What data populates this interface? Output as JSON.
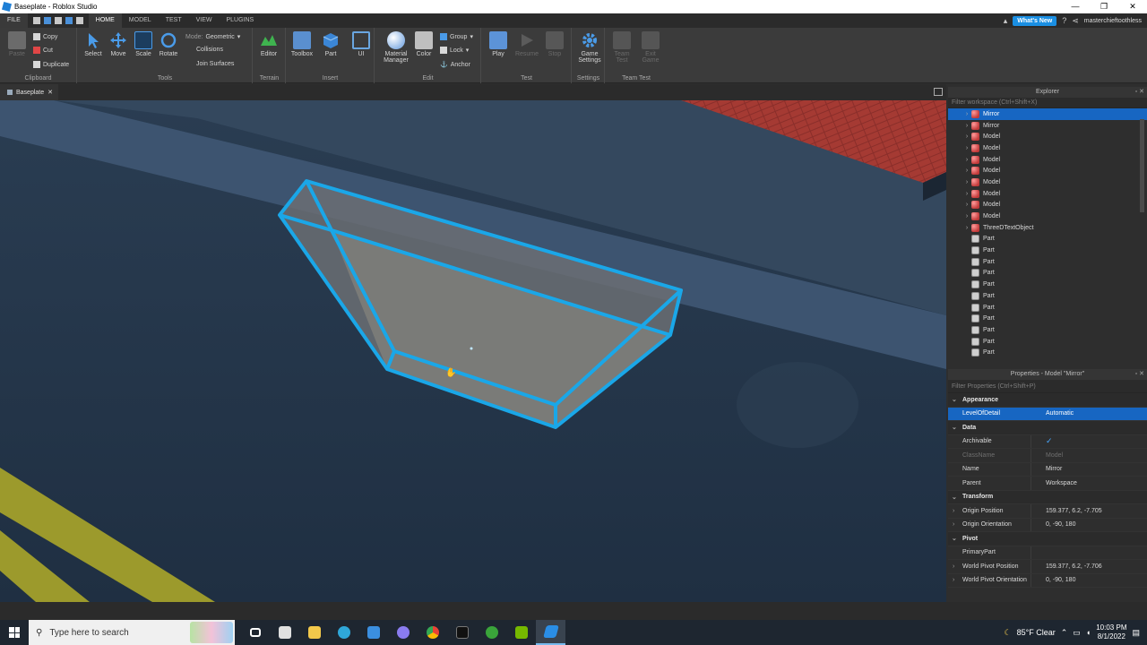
{
  "window": {
    "title": "Baseplate - Roblox Studio",
    "controls": [
      "—",
      "❐",
      "✕"
    ]
  },
  "menubar": {
    "tabs": [
      "FILE",
      "HOME",
      "MODEL",
      "TEST",
      "VIEW",
      "PLUGINS"
    ],
    "active_tab": "HOME",
    "whats_new": "What's New",
    "username": "masterchieftoothless"
  },
  "ribbon": {
    "clipboard": {
      "paste": "Paste",
      "copy": "Copy",
      "cut": "Cut",
      "duplicate": "Duplicate",
      "label": "Clipboard"
    },
    "tools": {
      "select": "Select",
      "move": "Move",
      "scale": "Scale",
      "rotate": "Rotate",
      "mode_label": "Mode:",
      "mode_value": "Geometric",
      "collisions": "Collisions",
      "join_surfaces": "Join Surfaces",
      "label": "Tools"
    },
    "terrain": {
      "editor": "Editor",
      "label": "Terrain"
    },
    "insert": {
      "toolbox": "Toolbox",
      "part": "Part",
      "ui": "UI",
      "label": "Insert"
    },
    "edit": {
      "material_manager_1": "Material",
      "material_manager_2": "Manager",
      "color": "Color",
      "group": "Group",
      "lock": "Lock",
      "anchor": "Anchor",
      "label": "Edit"
    },
    "test": {
      "play": "Play",
      "resume": "Resume",
      "stop": "Stop",
      "label": "Test"
    },
    "settings": {
      "game_settings_1": "Game",
      "game_settings_2": "Settings",
      "label": "Settings"
    },
    "team_test": {
      "team_test_1": "Team",
      "team_test_2": "Test",
      "exit_game_1": "Exit",
      "exit_game_2": "Game",
      "label": "Team Test"
    }
  },
  "document_tab": {
    "label": "Baseplate"
  },
  "explorer": {
    "title": "Explorer",
    "filter_placeholder": "Filter workspace (Ctrl+Shift+X)",
    "items": [
      {
        "label": "Mirror",
        "type": "model",
        "expandable": true,
        "selected": true
      },
      {
        "label": "Mirror",
        "type": "model",
        "expandable": true
      },
      {
        "label": "Model",
        "type": "model",
        "expandable": true
      },
      {
        "label": "Model",
        "type": "model",
        "expandable": true
      },
      {
        "label": "Model",
        "type": "model",
        "expandable": true
      },
      {
        "label": "Model",
        "type": "model",
        "expandable": true
      },
      {
        "label": "Model",
        "type": "model",
        "expandable": true
      },
      {
        "label": "Model",
        "type": "model",
        "expandable": true
      },
      {
        "label": "Model",
        "type": "model",
        "expandable": true
      },
      {
        "label": "Model",
        "type": "model",
        "expandable": true
      },
      {
        "label": "ThreeDTextObject",
        "type": "text3d",
        "expandable": true
      },
      {
        "label": "Part",
        "type": "part"
      },
      {
        "label": "Part",
        "type": "part"
      },
      {
        "label": "Part",
        "type": "part"
      },
      {
        "label": "Part",
        "type": "part"
      },
      {
        "label": "Part",
        "type": "part"
      },
      {
        "label": "Part",
        "type": "part"
      },
      {
        "label": "Part",
        "type": "part"
      },
      {
        "label": "Part",
        "type": "part"
      },
      {
        "label": "Part",
        "type": "part"
      },
      {
        "label": "Part",
        "type": "part"
      },
      {
        "label": "Part",
        "type": "part"
      }
    ]
  },
  "properties": {
    "title": "Properties - Model \"Mirror\"",
    "filter_placeholder": "Filter Properties (Ctrl+Shift+P)",
    "rows": [
      {
        "kind": "section",
        "name": "Appearance"
      },
      {
        "kind": "prop",
        "name": "LevelOfDetail",
        "value": "Automatic",
        "selected": true
      },
      {
        "kind": "section",
        "name": "Data"
      },
      {
        "kind": "prop",
        "name": "Archivable",
        "value": "✓",
        "check": true
      },
      {
        "kind": "prop",
        "name": "ClassName",
        "value": "Model",
        "dim": true
      },
      {
        "kind": "prop",
        "name": "Name",
        "value": "Mirror"
      },
      {
        "kind": "prop",
        "name": "Parent",
        "value": "Workspace"
      },
      {
        "kind": "section",
        "name": "Transform"
      },
      {
        "kind": "prop",
        "name": "Origin Position",
        "value": "159.377, 6.2, -7.705",
        "expand": true
      },
      {
        "kind": "prop",
        "name": "Origin Orientation",
        "value": "0, -90, 180",
        "expand": true
      },
      {
        "kind": "section",
        "name": "Pivot"
      },
      {
        "kind": "prop",
        "name": "PrimaryPart",
        "value": ""
      },
      {
        "kind": "prop",
        "name": "World Pivot Position",
        "value": "159.377, 6.2, -7.706",
        "expand": true
      },
      {
        "kind": "prop",
        "name": "World Pivot Orientation",
        "value": "0, -90, 180",
        "expand": true
      }
    ]
  },
  "taskbar": {
    "search_placeholder": "Type here to search",
    "weather": "85°F  Clear",
    "time": "10:03 PM",
    "date": "8/1/2022"
  },
  "colors": {
    "selection_blue": "#1766c2",
    "outline_cyan": "#1aa7e8",
    "whats_new_blue": "#1a8fe3"
  }
}
